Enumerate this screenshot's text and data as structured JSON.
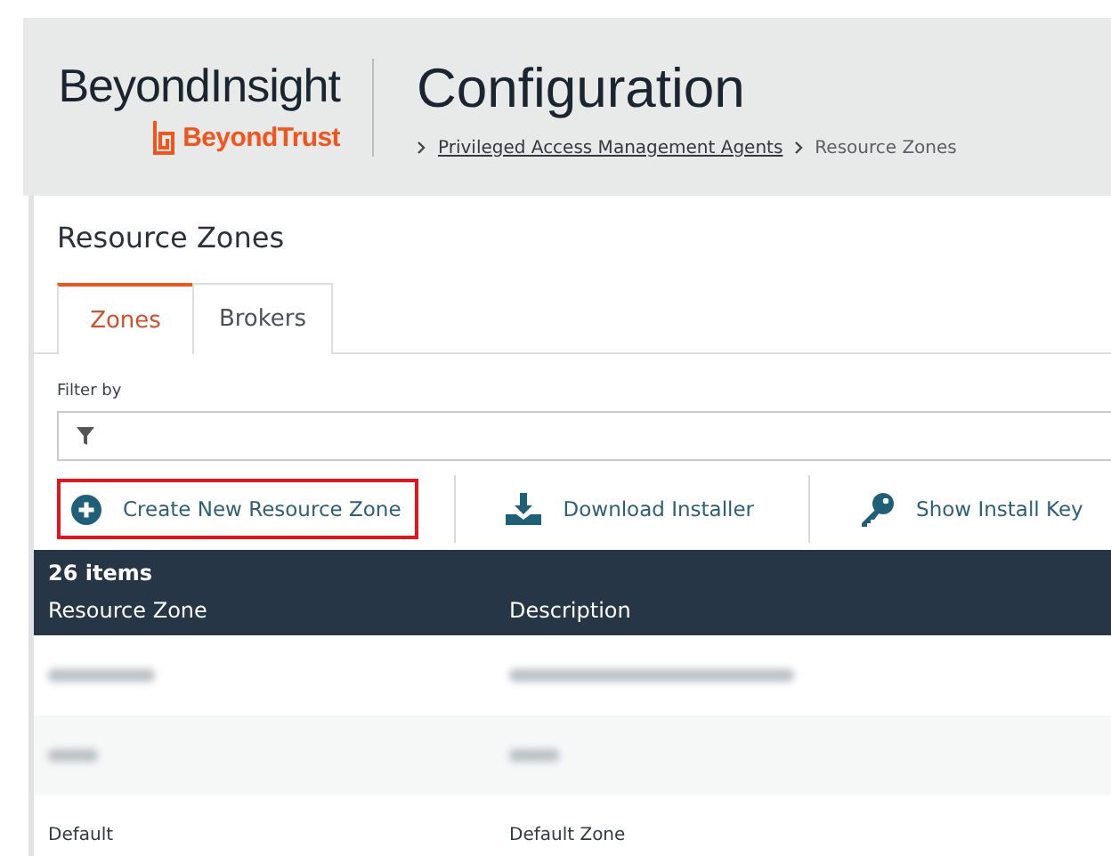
{
  "header": {
    "product": "BeyondInsight",
    "brand": "BeyondTrust",
    "title": "Configuration",
    "breadcrumb": [
      {
        "label": "Privileged Access Management Agents",
        "link": true
      },
      {
        "label": "Resource Zones",
        "link": false
      }
    ]
  },
  "panel": {
    "title": "Resource Zones",
    "tabs": [
      {
        "label": "Zones",
        "selected": true
      },
      {
        "label": "Brokers",
        "selected": false
      }
    ],
    "filter": {
      "label": "Filter by"
    },
    "actions": [
      {
        "label": "Create New Resource Zone",
        "highlighted": true
      },
      {
        "label": "Download Installer",
        "highlighted": false
      },
      {
        "label": "Show Install Key",
        "highlighted": false
      }
    ],
    "table": {
      "count": "26 items",
      "columns": [
        "Resource Zone",
        "Description"
      ],
      "rows": [
        {
          "kind": "redacted"
        },
        {
          "kind": "redacted"
        },
        {
          "kind": "text",
          "cells": [
            "Default",
            "Default Zone"
          ]
        }
      ]
    }
  }
}
